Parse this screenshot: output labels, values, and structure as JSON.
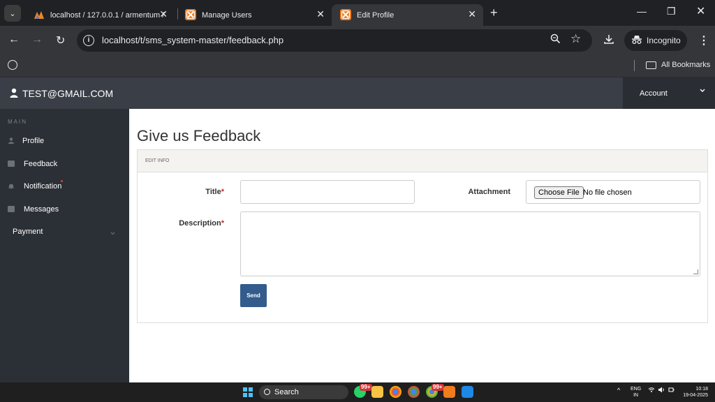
{
  "browser": {
    "tabs": [
      {
        "title": "localhost / 127.0.0.1 / armentum /",
        "active": false
      },
      {
        "title": "Manage Users",
        "active": false
      },
      {
        "title": "Edit Profile",
        "active": true
      }
    ],
    "url": "localhost/t/sms_system-master/feedback.php",
    "incognito_label": "Incognito",
    "all_bookmarks_label": "All Bookmarks"
  },
  "header": {
    "user_email": "TEST@GMAIL.COM",
    "account_label": "Account"
  },
  "sidebar": {
    "section_label": "MAIN",
    "items": [
      {
        "label": "Profile",
        "icon": "user-icon"
      },
      {
        "label": "Feedback",
        "icon": "envelope-icon"
      },
      {
        "label": "Notification",
        "icon": "bell-icon",
        "has_dot": true
      },
      {
        "label": "Messages",
        "icon": "envelope-icon"
      },
      {
        "label": "Payment",
        "icon": "chevron-down-icon"
      }
    ]
  },
  "main": {
    "title": "Give us Feedback",
    "panel_title": "EDIT INFO",
    "title_label": "Title",
    "attachment_label": "Attachment",
    "choose_file_label": "Choose File",
    "no_file_text": "No file chosen",
    "description_label": "Description",
    "required_mark": "*",
    "send_label": "Send",
    "title_value": "",
    "description_value": ""
  },
  "taskbar": {
    "search_label": "Search",
    "badge_1": "99+",
    "badge_2": "99+",
    "lang_line1": "ENG",
    "lang_line2": "IN",
    "time": "10:18",
    "date": "19-04-2025"
  },
  "colors": {
    "topbar": "#3a3f47",
    "sidebar": "#2b2f36",
    "send_button": "#335c8c",
    "required": "#c62828"
  }
}
